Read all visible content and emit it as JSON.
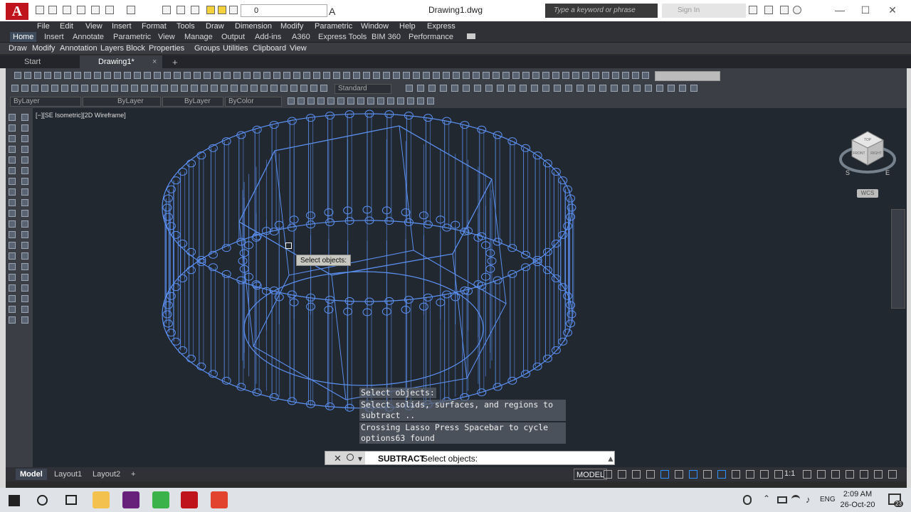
{
  "titlebar": {
    "logo_letter": "A",
    "layer_value": "0",
    "doc_title": "Drawing1.dwg",
    "search_placeholder": "Type a keyword or phrase",
    "signin_label": "Sign In",
    "minimize": "—",
    "maximize": "☐",
    "close": "✕"
  },
  "menubar": {
    "items": [
      "File",
      "Edit",
      "View",
      "Insert",
      "Format",
      "Tools",
      "Draw",
      "Dimension",
      "Modify",
      "Parametric",
      "Window",
      "Help",
      "Express"
    ]
  },
  "ribbon": {
    "tabs": [
      "Home",
      "Insert",
      "Annotate",
      "Parametric",
      "View",
      "Manage",
      "Output",
      "Add-ins",
      "A360",
      "Express Tools",
      "BIM 360",
      "Performance"
    ],
    "panels": [
      "Draw",
      "Modify",
      "Annotation",
      "Layers",
      "Block",
      "Properties",
      "Groups",
      "Utilities",
      "Clipboard",
      "View"
    ]
  },
  "filetabs": {
    "start": "Start",
    "active": "Drawing1*",
    "close": "×",
    "add": "+"
  },
  "toolbars": {
    "style_combo": "Standard",
    "layer_combo": "ByLayer",
    "linetype_combo": "ByLayer",
    "lineweight_combo": "ByLayer",
    "color_combo": "ByColor"
  },
  "viewport": {
    "label": "[−][SE Isometric][2D Wireframe]",
    "tooltip": "Select objects:",
    "wcs": "WCS",
    "viewcube_faces": [
      "TOP",
      "FRONT",
      "RIGHT"
    ],
    "viewcube_compass": [
      "S",
      "E"
    ]
  },
  "command": {
    "history": [
      "Select objects:",
      "Select solids, surfaces, and regions to subtract ..",
      "Crossing Lasso  Press Spacebar to cycle options63 found"
    ],
    "prompt_cmd": "SUBTRACT",
    "prompt_text": "Select objects:"
  },
  "statusbar": {
    "tabs": [
      "Model",
      "Layout1",
      "Layout2"
    ],
    "model_space": "MODEL",
    "scale": "1:1"
  },
  "taskbar": {
    "language": "ENG",
    "time": "2:09 AM",
    "date": "26-Oct-20",
    "notifications": "23"
  },
  "colors": {
    "accent_red": "#c0141c",
    "wire_blue": "#5b8ff0",
    "viewport_bg": "#212830"
  }
}
